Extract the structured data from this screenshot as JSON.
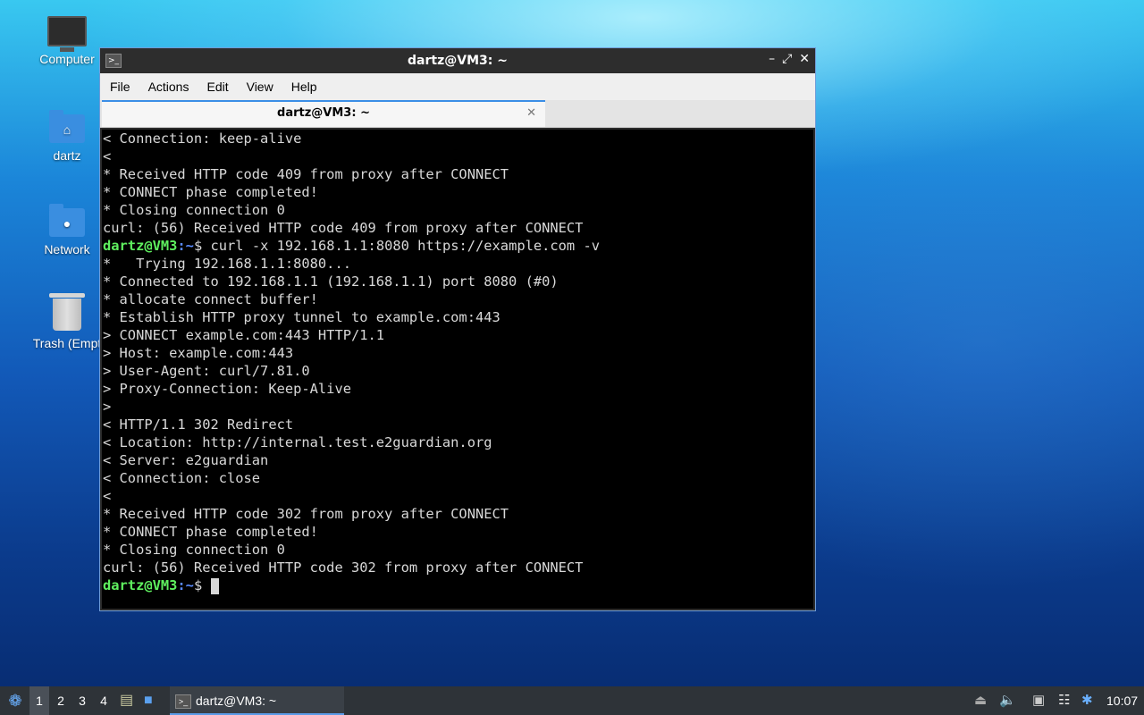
{
  "desktop": {
    "icons": [
      {
        "label": "Computer",
        "icon": "computer-icon"
      },
      {
        "label": "dartz",
        "icon": "home-folder-icon"
      },
      {
        "label": "Network",
        "icon": "network-folder-icon"
      },
      {
        "label": "Trash (Empt",
        "icon": "trash-icon"
      }
    ]
  },
  "window": {
    "title": "dartz@VM3: ~",
    "menu": [
      "File",
      "Actions",
      "Edit",
      "View",
      "Help"
    ],
    "tab": {
      "label": "dartz@VM3: ~"
    },
    "prompt_user": "dartz@VM3",
    "prompt_path": ":~",
    "prompt_symbol": "$",
    "terminal_lines": [
      "< Connection: keep-alive",
      "<",
      "* Received HTTP code 409 from proxy after CONNECT",
      "* CONNECT phase completed!",
      "* Closing connection 0",
      "curl: (56) Received HTTP code 409 from proxy after CONNECT",
      "*   Trying 192.168.1.1:8080...",
      "* Connected to 192.168.1.1 (192.168.1.1) port 8080 (#0)",
      "* allocate connect buffer!",
      "* Establish HTTP proxy tunnel to example.com:443",
      "> CONNECT example.com:443 HTTP/1.1",
      "> Host: example.com:443",
      "> User-Agent: curl/7.81.0",
      "> Proxy-Connection: Keep-Alive",
      ">",
      "< HTTP/1.1 302 Redirect",
      "< Location: http://internal.test.e2guardian.org",
      "< Server: e2guardian",
      "< Connection: close",
      "<",
      "* Received HTTP code 302 from proxy after CONNECT",
      "* CONNECT phase completed!",
      "* Closing connection 0",
      "curl: (56) Received HTTP code 302 from proxy after CONNECT"
    ],
    "command": " curl -x 192.168.1.1:8080 https://example.com -v"
  },
  "taskbar": {
    "workspaces": [
      "1",
      "2",
      "3",
      "4"
    ],
    "active_workspace": "1",
    "task_label": "dartz@VM3: ~",
    "clock": "10:07"
  }
}
